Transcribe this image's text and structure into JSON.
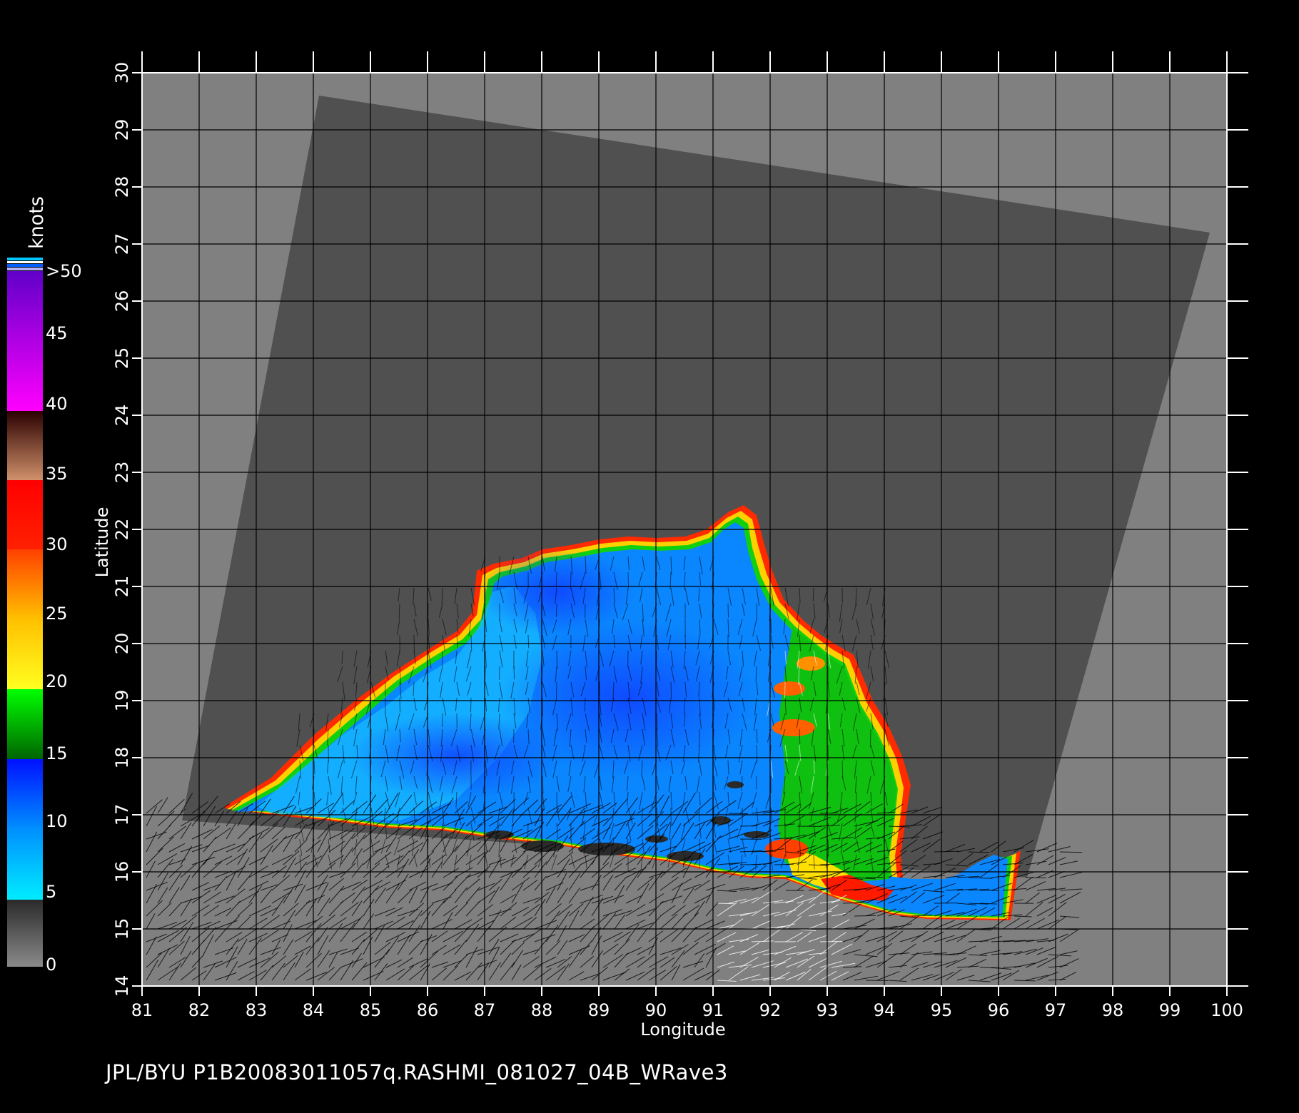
{
  "map": {
    "x_axis": {
      "label": "Longitude",
      "min": 81,
      "max": 100,
      "ticks": [
        "81",
        "82",
        "83",
        "84",
        "85",
        "86",
        "87",
        "88",
        "89",
        "90",
        "91",
        "92",
        "93",
        "94",
        "95",
        "96",
        "97",
        "98",
        "99",
        "100"
      ]
    },
    "y_axis": {
      "label": "Latitude",
      "min": 14,
      "max": 30,
      "ticks": [
        "14",
        "15",
        "16",
        "17",
        "18",
        "19",
        "20",
        "21",
        "22",
        "23",
        "24",
        "25",
        "26",
        "27",
        "28",
        "29",
        "30"
      ]
    },
    "grid": true,
    "swath_corners": [
      [
        84.1,
        29.6
      ],
      [
        99.7,
        27.2
      ],
      [
        96.5,
        15.9
      ],
      [
        81.7,
        16.9
      ]
    ],
    "colors": {
      "background": "#000000",
      "frame": "#808080",
      "swath": "#505050",
      "grid": "#000000",
      "axes": "#ffffff"
    }
  },
  "colorbar": {
    "unit": "knots",
    "labels": [
      ">50",
      "45",
      "40",
      "35",
      "30",
      "25",
      "20",
      "15",
      "10",
      "5",
      "0"
    ],
    "stops": [
      {
        "value": 0,
        "color": "#808080"
      },
      {
        "value": 5,
        "color": "#303030"
      },
      {
        "value": 5,
        "color": "#00e8ff"
      },
      {
        "value": 10,
        "color": "#0090ff"
      },
      {
        "value": 15,
        "color": "#0000ff"
      },
      {
        "value": 15,
        "color": "#006000"
      },
      {
        "value": 20,
        "color": "#00ff00"
      },
      {
        "value": 20,
        "color": "#ffff00"
      },
      {
        "value": 25,
        "color": "#ffa000"
      },
      {
        "value": 30,
        "color": "#ff4000"
      },
      {
        "value": 35,
        "color": "#ff0000"
      },
      {
        "value": 35,
        "color": "#d09070"
      },
      {
        "value": 40,
        "color": "#300000"
      },
      {
        "value": 40,
        "color": "#ff00ff"
      },
      {
        "value": 50,
        "color": "#6000c0"
      }
    ]
  },
  "footer": "JPL/BYU  P1B20083011057q.RASHMI_081027_04B_WRave3"
}
